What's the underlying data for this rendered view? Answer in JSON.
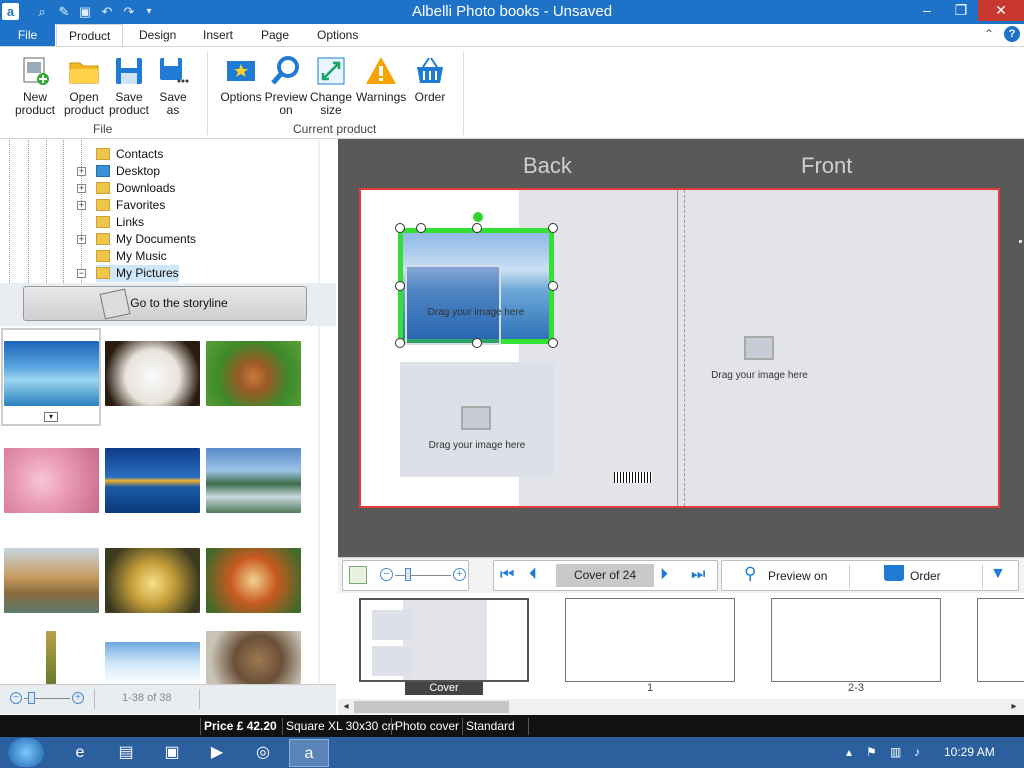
{
  "window": {
    "title": "Albelli Photo books - Unsaved",
    "app_icon": "a"
  },
  "quick_access": [
    "search-icon",
    "edit-icon",
    "save-icon",
    "undo-icon",
    "redo-icon",
    "dropdown-icon"
  ],
  "tabs": [
    "File",
    "Product",
    "Design",
    "Insert",
    "Page",
    "Options"
  ],
  "ribbon": {
    "file_group": {
      "label": "File",
      "buttons": [
        {
          "label1": "New",
          "label2": "product",
          "icon": "new-product-icon"
        },
        {
          "label1": "Open",
          "label2": "product",
          "icon": "folder-icon"
        },
        {
          "label1": "Save",
          "label2": "product",
          "icon": "save-icon"
        },
        {
          "label1": "Save",
          "label2": "as",
          "icon": "save-as-icon"
        }
      ]
    },
    "current_group": {
      "label": "Current product",
      "buttons": [
        {
          "label1": "Options",
          "label2": "",
          "icon": "options-icon"
        },
        {
          "label1": "Preview",
          "label2": "on",
          "icon": "magnifier-icon"
        },
        {
          "label1": "Change",
          "label2": "size",
          "icon": "resize-icon"
        },
        {
          "label1": "Warnings",
          "label2": "",
          "icon": "warning-icon"
        },
        {
          "label1": "Order",
          "label2": "",
          "icon": "basket-icon"
        }
      ]
    }
  },
  "tree": [
    "Contacts",
    "Desktop",
    "Downloads",
    "Favorites",
    "Links",
    "My Documents",
    "My Music",
    "My Pictures"
  ],
  "storyline_button": "Go to the storyline",
  "gallery_footer": {
    "count": "1-38 of 38"
  },
  "canvas": {
    "back_label": "Back",
    "front_label": "Front",
    "placeholder": "Drag your image here"
  },
  "navbar": {
    "page_indicator": "Cover of 24",
    "preview": "Preview on",
    "order": "Order"
  },
  "pages": [
    {
      "label": "Cover"
    },
    {
      "label": "1"
    },
    {
      "label": "2-3"
    },
    {
      "label": ""
    }
  ],
  "status": {
    "price": "Price £ 42.20",
    "size": "Square XL 30x30 cm",
    "cover": "Photo cover",
    "quality": "Standard"
  },
  "taskbar": {
    "time": "10:29 AM"
  }
}
